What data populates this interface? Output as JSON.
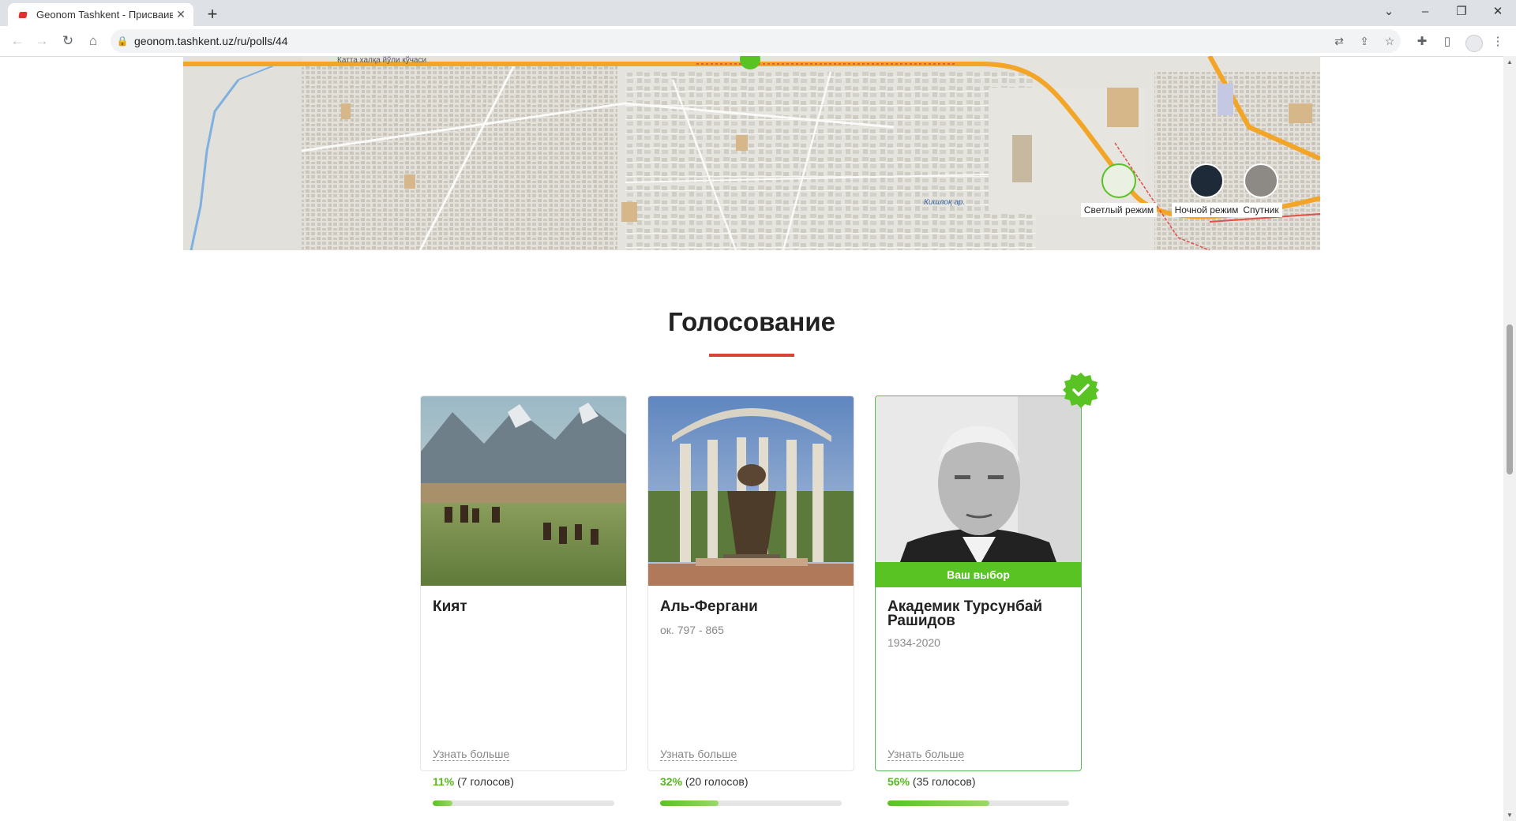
{
  "browser": {
    "tab_title": "Geonom Tashkent - Присваивае",
    "url": "geonom.tashkent.uz/ru/polls/44"
  },
  "map": {
    "street_label": "Катта халқа йўли кўчаси",
    "canal_label": "Кишлоқ ар.",
    "modes": [
      {
        "label": "Светлый режим",
        "icon": "light-map-icon"
      },
      {
        "label": "Ночной режим",
        "icon": "night-map-icon"
      },
      {
        "label": "Спутник",
        "icon": "satellite-map-icon"
      }
    ]
  },
  "poll": {
    "title": "Голосование",
    "more_label": "Узнать больше",
    "choice_label": "Ваш выбор",
    "candidates": [
      {
        "name": "Кият",
        "dates": "",
        "percent": "11%",
        "votes": "(7 голосов)",
        "share": 0.11,
        "selected": false
      },
      {
        "name": "Аль-Фергани",
        "dates": "ок. 797 - 865",
        "percent": "32%",
        "votes": "(20 голосов)",
        "share": 0.32,
        "selected": false
      },
      {
        "name": "Академик Турсунбай Рашидов",
        "dates": "1934-2020",
        "percent": "56%",
        "votes": "(35 голосов)",
        "share": 0.56,
        "selected": true
      }
    ]
  },
  "colors": {
    "accent_green": "#58c322",
    "title_underline": "#d8443a"
  }
}
